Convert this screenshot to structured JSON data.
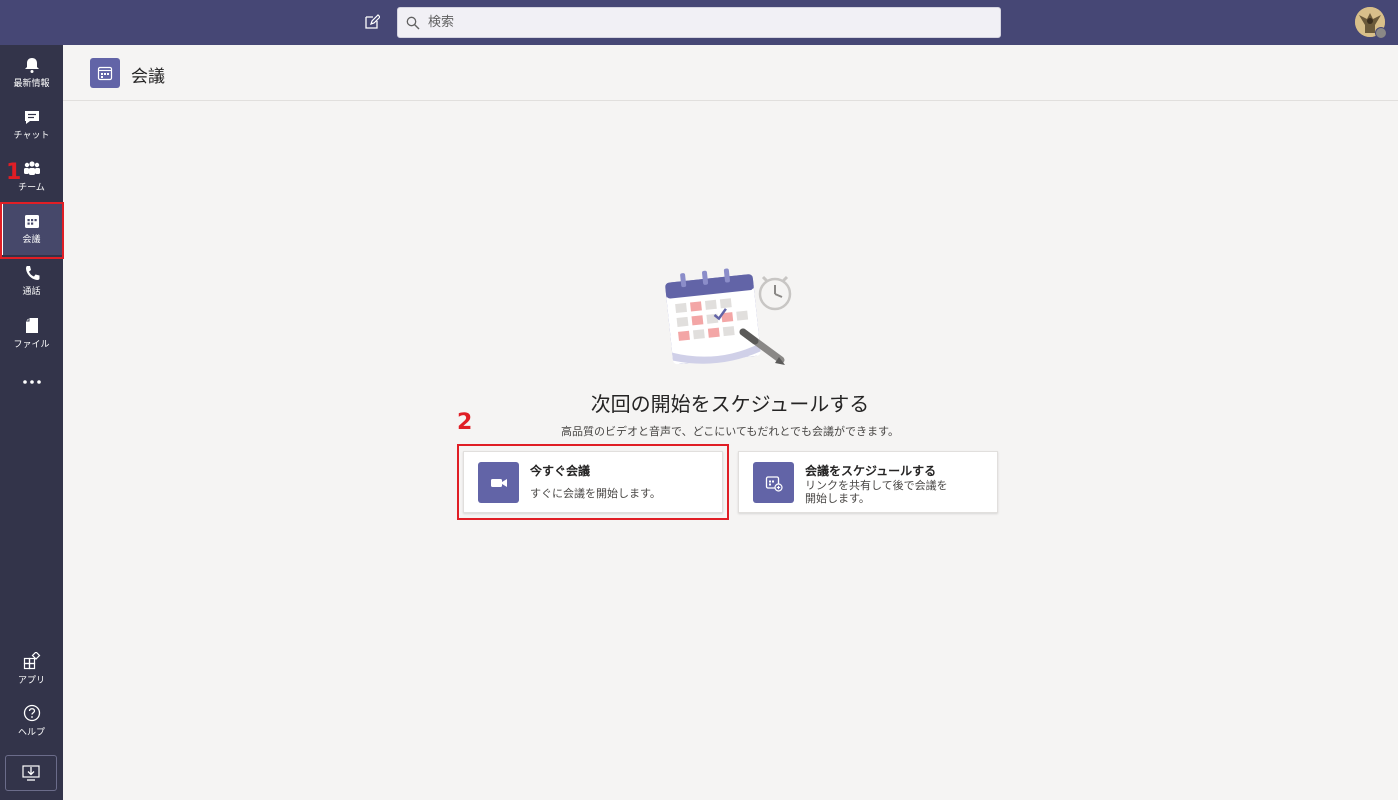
{
  "topbar": {
    "search_placeholder": "検索",
    "compose_icon": "compose-icon",
    "avatar_icon": "avatar"
  },
  "rail": {
    "items": [
      {
        "label": "最新情報",
        "icon": "bell-icon"
      },
      {
        "label": "チャット",
        "icon": "chat-icon"
      },
      {
        "label": "チーム",
        "icon": "teams-icon"
      },
      {
        "label": "会議",
        "icon": "calendar-icon",
        "active": true
      },
      {
        "label": "通話",
        "icon": "phone-icon"
      },
      {
        "label": "ファイル",
        "icon": "file-icon"
      },
      {
        "label": "…",
        "icon": "more-icon"
      }
    ],
    "bottom": [
      {
        "label": "アプリ",
        "icon": "apps-icon"
      },
      {
        "label": "ヘルプ",
        "icon": "help-icon"
      }
    ],
    "download_icon": "download-icon"
  },
  "header": {
    "title": "会議"
  },
  "content": {
    "title": "次回の開始をスケジュールする",
    "subtitle": "高品質のビデオと音声で、どこにいてもだれとでも会議ができます。",
    "cards": [
      {
        "title": "今すぐ会議",
        "desc": "すぐに会議を開始します。",
        "icon": "video-icon"
      },
      {
        "title": "会議をスケジュールする",
        "desc_line1": "リンクを共有して後で会議を",
        "desc_line2": "開始します。",
        "icon": "calendar-add-icon"
      }
    ]
  },
  "annotations": {
    "step1": "1",
    "step2": "2",
    "color": "#e01e25"
  },
  "colors": {
    "brand": "#6264a7",
    "topbar": "#464775",
    "rail": "#33344a"
  }
}
